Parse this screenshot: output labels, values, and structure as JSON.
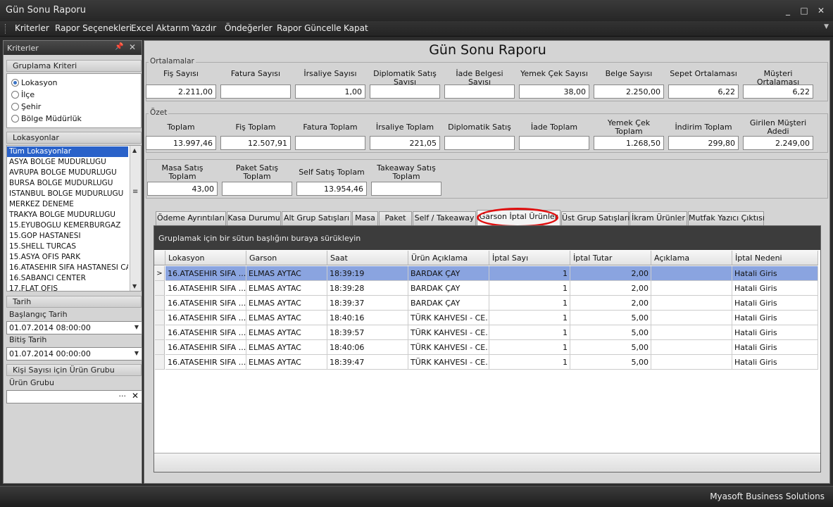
{
  "window": {
    "title": "Gün Sonu Raporu"
  },
  "menu": [
    "Kriterler",
    "Rapor Seçenekleri",
    "Excel Aktarım",
    "Yazdır",
    "Öndeğerler",
    "Rapor Güncelle",
    "Kapat"
  ],
  "left": {
    "panel_title": "Kriterler",
    "grouping": {
      "title": "Gruplama Kriteri",
      "options": [
        "Lokasyon",
        "İlçe",
        "Şehir",
        "Bölge Müdürlük"
      ],
      "selected": "Lokasyon"
    },
    "locations": {
      "title": "Lokasyonlar",
      "items": [
        "Tüm Lokasyonlar",
        "ASYA BOLGE MUDURLUGU",
        "AVRUPA BOLGE MUDURLUGU",
        "BURSA BOLGE MUDURLUGU",
        "ISTANBUL BOLGE MUDURLUGU",
        "MERKEZ DENEME",
        "TRAKYA BOLGE MUDURLUGU",
        "15.EYUBOGLU KEMERBURGAZ",
        "15.GOP HASTANESI",
        "15.SHELL TURCAS",
        "15.ASYA OFIS PARK",
        "16.ATASEHIR SIFA HASTANESI CA",
        "16.SABANCI CENTER",
        "17.FLAT OFIS"
      ]
    },
    "date": {
      "title": "Tarih",
      "start_label": "Başlangıç Tarih",
      "start_value": "01.07.2014 08:00:00",
      "end_label": "Bitiş Tarih",
      "end_value": "01.07.2014 00:00:00"
    },
    "product": {
      "title": "Kişi Sayısı için Ürün Grubu",
      "label": "Ürün Grubu",
      "value": ""
    }
  },
  "report_title": "Gün Sonu Raporu",
  "averages": {
    "title": "Ortalamalar",
    "fields": [
      {
        "label": "Fiş Sayısı",
        "value": "2.211,00"
      },
      {
        "label": "Fatura Sayısı",
        "value": ""
      },
      {
        "label": "İrsaliye Sayısı",
        "value": "1,00"
      },
      {
        "label": "Diplomatik Satış Sayısı",
        "value": ""
      },
      {
        "label": "İade Belgesi Sayısı",
        "value": ""
      },
      {
        "label": "Yemek Çek Sayısı",
        "value": "38,00"
      },
      {
        "label": "Belge Sayısı",
        "value": "2.250,00"
      },
      {
        "label": "Sepet Ortalaması",
        "value": "6,22"
      },
      {
        "label": "Müşteri Ortalaması",
        "value": "6,22"
      }
    ]
  },
  "summary": {
    "title": "Özet",
    "fields": [
      {
        "label": "Toplam",
        "value": "13.997,46"
      },
      {
        "label": "Fiş Toplam",
        "value": "12.507,91"
      },
      {
        "label": "Fatura Toplam",
        "value": ""
      },
      {
        "label": "İrsaliye Toplam",
        "value": "221,05"
      },
      {
        "label": "Diplomatik Satış",
        "value": ""
      },
      {
        "label": "İade Toplam",
        "value": ""
      },
      {
        "label": "Yemek Çek Toplam",
        "value": "1.268,50"
      },
      {
        "label": "İndirim Toplam",
        "value": "299,80"
      },
      {
        "label": "Girilen Müşteri Adedi",
        "value": "2.249,00"
      }
    ]
  },
  "sales": {
    "fields": [
      {
        "label": "Masa Satış Toplam",
        "value": "43,00"
      },
      {
        "label": "Paket Satış Toplam",
        "value": ""
      },
      {
        "label": "Self Satış Toplam",
        "value": "13.954,46"
      },
      {
        "label": "Takeaway Satış Toplam",
        "value": ""
      }
    ]
  },
  "tabs": [
    "Ödeme Ayrıntıları",
    "Kasa Durumu",
    "Alt Grup Satışları",
    "Masa",
    "Paket",
    "Self / Takeaway",
    "Garson İptal Ürünler",
    "Üst Grup Satışları",
    "İkram Ürünler",
    "Mutfak Yazıcı Çıktısı"
  ],
  "active_tab": "Garson İptal Ürünler",
  "grid": {
    "group_hint": "Gruplamak için bir sütun başlığını buraya sürükleyin",
    "columns": [
      "Lokasyon",
      "Garson",
      "Saat",
      "Ürün Açıklama",
      "İptal Sayı",
      "İptal Tutar",
      "Açıklama",
      "İptal Nedeni"
    ],
    "rows": [
      [
        "16.ATASEHIR SIFA ...",
        "ELMAS AYTAC",
        "18:39:19",
        "BARDAK ÇAY",
        "1",
        "2,00",
        "",
        "Hatali Giris"
      ],
      [
        "16.ATASEHIR SIFA ...",
        "ELMAS AYTAC",
        "18:39:28",
        "BARDAK ÇAY",
        "1",
        "2,00",
        "",
        "Hatali Giris"
      ],
      [
        "16.ATASEHIR SIFA ...",
        "ELMAS AYTAC",
        "18:39:37",
        "BARDAK ÇAY",
        "1",
        "2,00",
        "",
        "Hatali Giris"
      ],
      [
        "16.ATASEHIR SIFA ...",
        "ELMAS AYTAC",
        "18:40:16",
        "TÜRK KAHVESI - CE...",
        "1",
        "5,00",
        "",
        "Hatali Giris"
      ],
      [
        "16.ATASEHIR SIFA ...",
        "ELMAS AYTAC",
        "18:39:57",
        "TÜRK KAHVESI - CE...",
        "1",
        "5,00",
        "",
        "Hatali Giris"
      ],
      [
        "16.ATASEHIR SIFA ...",
        "ELMAS AYTAC",
        "18:40:06",
        "TÜRK KAHVESI - CE...",
        "1",
        "5,00",
        "",
        "Hatali Giris"
      ],
      [
        "16.ATASEHIR SIFA ...",
        "ELMAS AYTAC",
        "18:39:47",
        "TÜRK KAHVESI - CE...",
        "1",
        "5,00",
        "",
        "Hatali Giris"
      ]
    ],
    "selected_row": 0
  },
  "status": "Myasoft Business Solutions",
  "colors": {
    "selection": "#8aa4e0",
    "highlight_circle": "#e01010"
  }
}
